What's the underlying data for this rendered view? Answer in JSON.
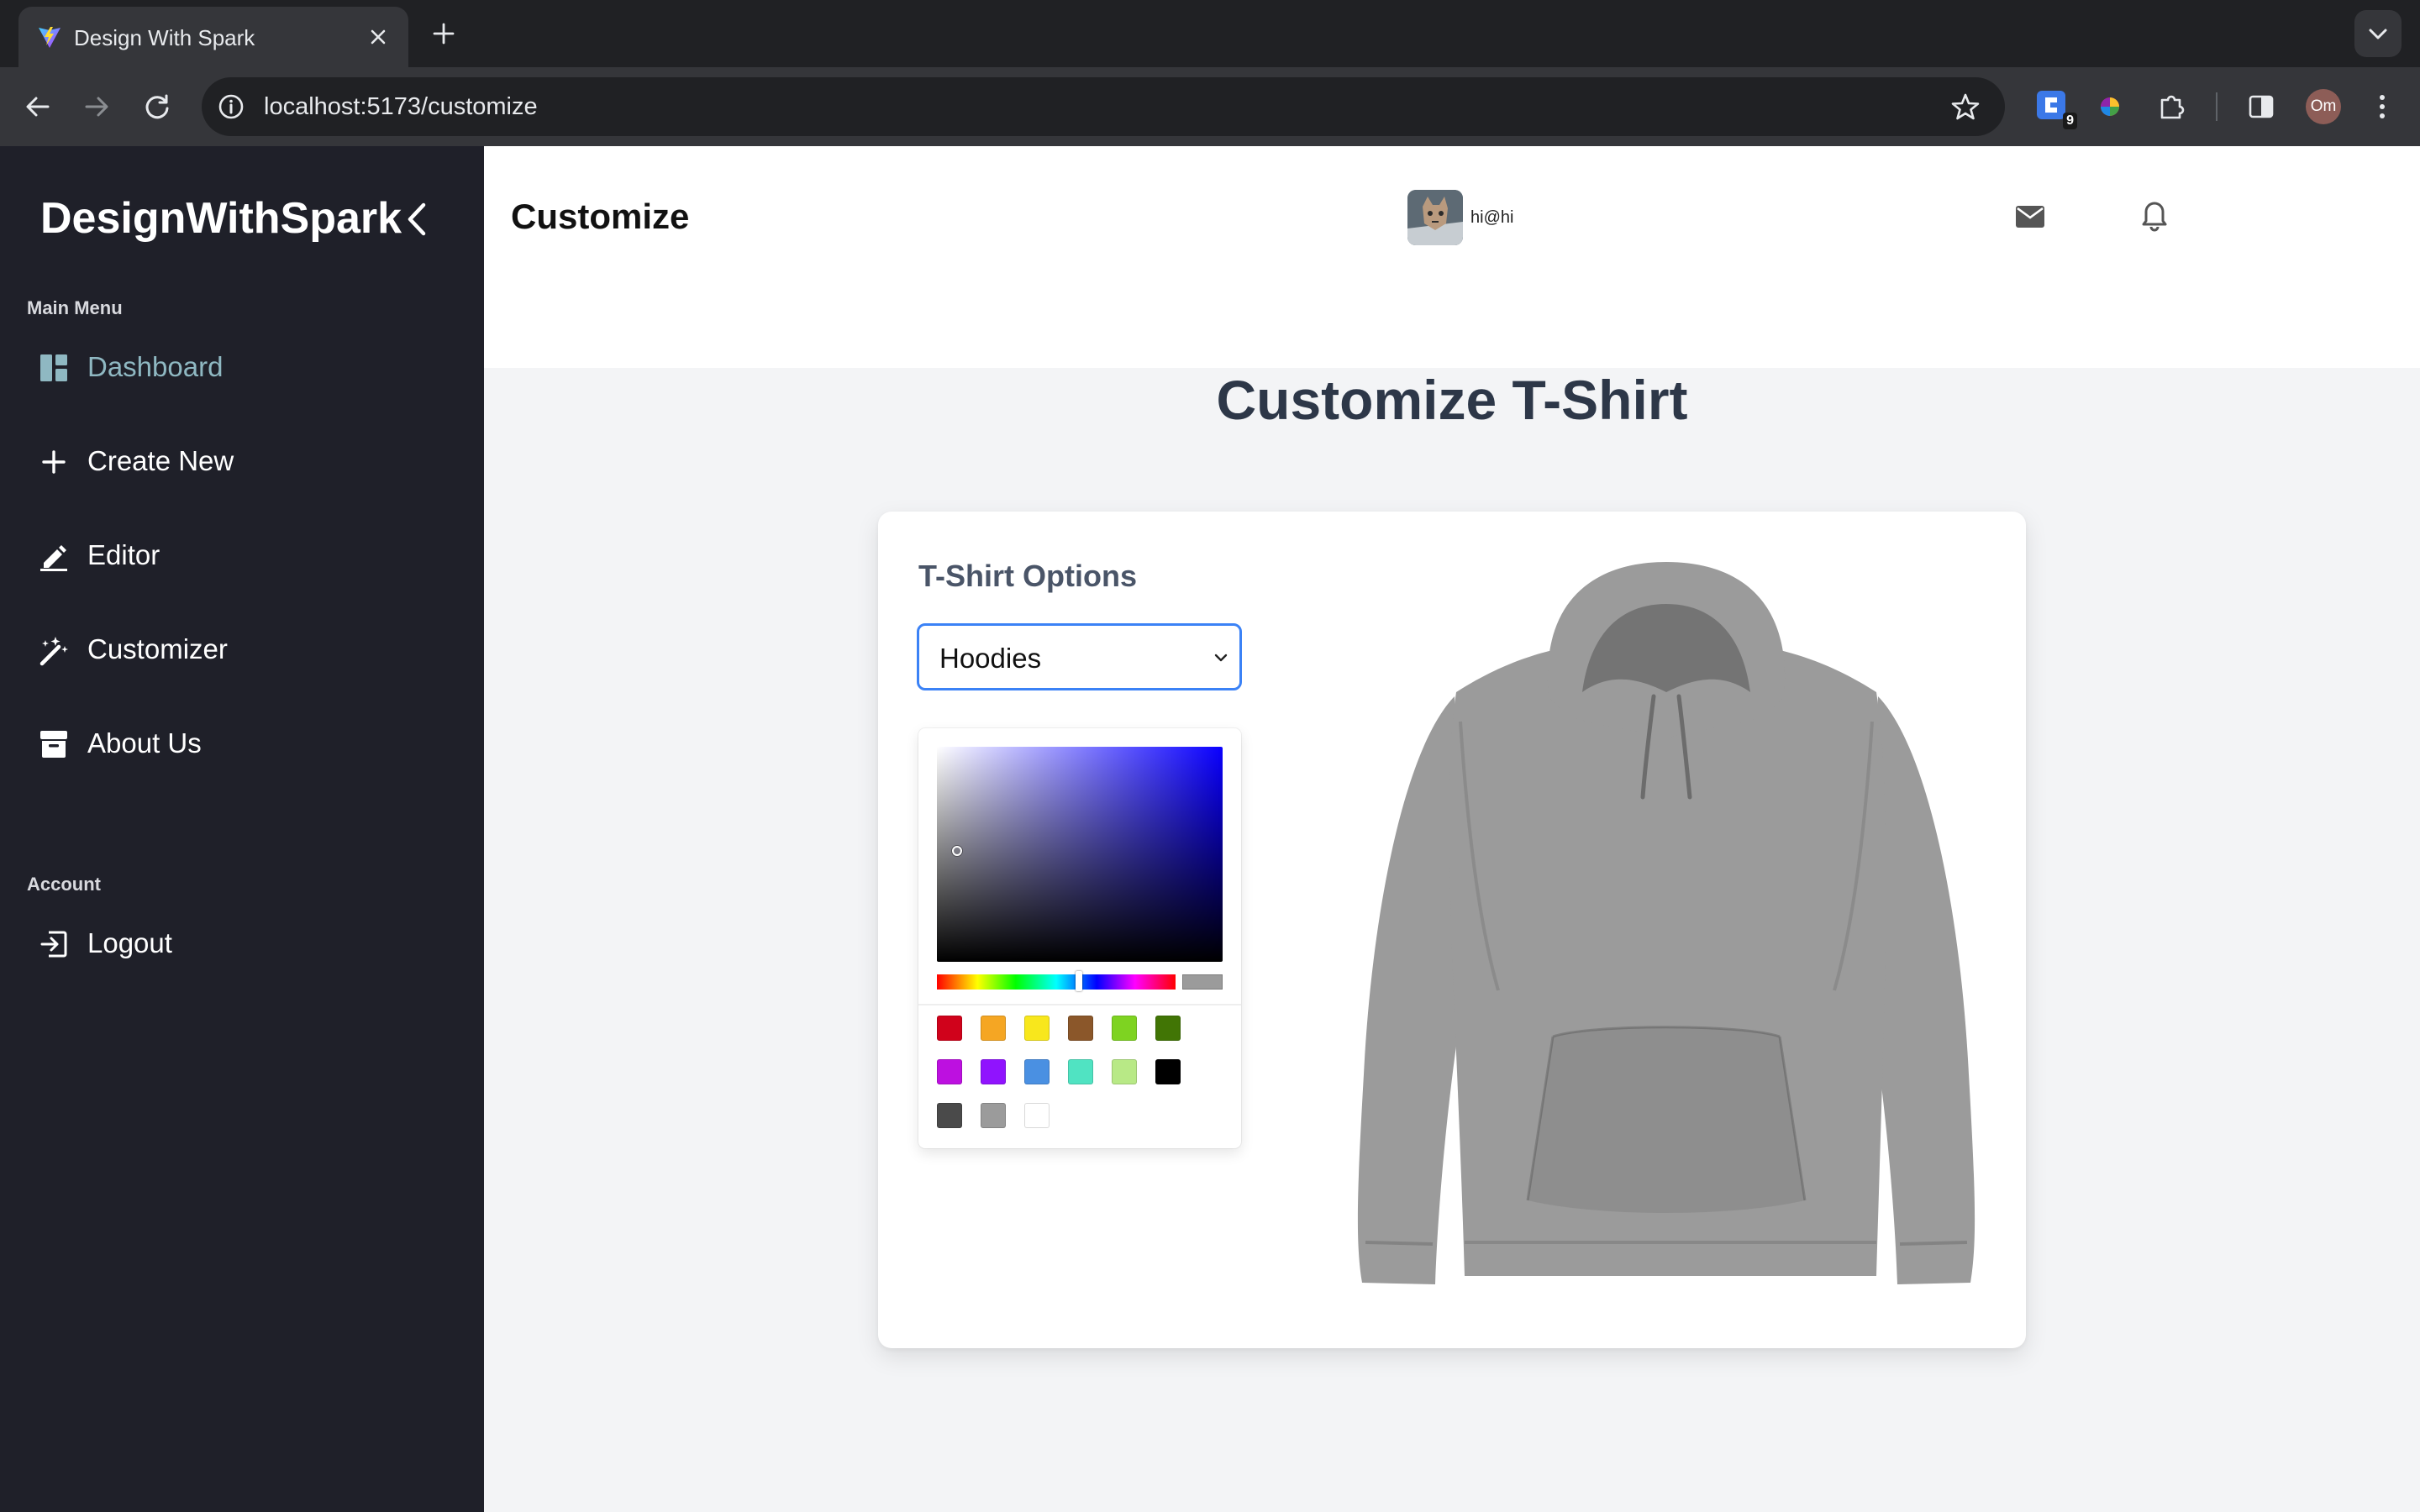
{
  "browser": {
    "tab_title": "Design With Spark",
    "url": "localhost:5173/customize",
    "ext_badge": "9",
    "profile_initials": "Om"
  },
  "sidebar": {
    "brand": "DesignWithSpark",
    "main_menu_label": "Main Menu",
    "account_label": "Account",
    "items": [
      {
        "label": "Dashboard",
        "icon": "dashboard-icon",
        "active": true
      },
      {
        "label": "Create New",
        "icon": "plus-icon"
      },
      {
        "label": "Editor",
        "icon": "pencil-icon"
      },
      {
        "label": "Customizer",
        "icon": "magic-wand-icon"
      },
      {
        "label": "About Us",
        "icon": "archive-icon"
      }
    ],
    "logout": {
      "label": "Logout",
      "icon": "logout-icon"
    }
  },
  "header": {
    "title": "Customize",
    "user_email": "hi@hi"
  },
  "main": {
    "heading": "Customize T-Shirt",
    "options_title": "T-Shirt Options",
    "select_value": "Hoodies",
    "garment_color": "#9b9b9b"
  },
  "color_picker": {
    "hue_color": "#0a00ff",
    "selected_color": "#9b9b9b",
    "presets": [
      "#d0021b",
      "#f5a623",
      "#f8e71c",
      "#8b572a",
      "#7ed321",
      "#417505",
      "#bd10e0",
      "#9013fe",
      "#4a90e2",
      "#50e3c2",
      "#b8e986",
      "#000000",
      "#4a4a4a",
      "#9b9b9b",
      "#ffffff"
    ]
  },
  "colors": {
    "sidebar_bg": "#1f2029",
    "active_nav": "#8fb8c2",
    "select_border": "#3b82f6"
  }
}
